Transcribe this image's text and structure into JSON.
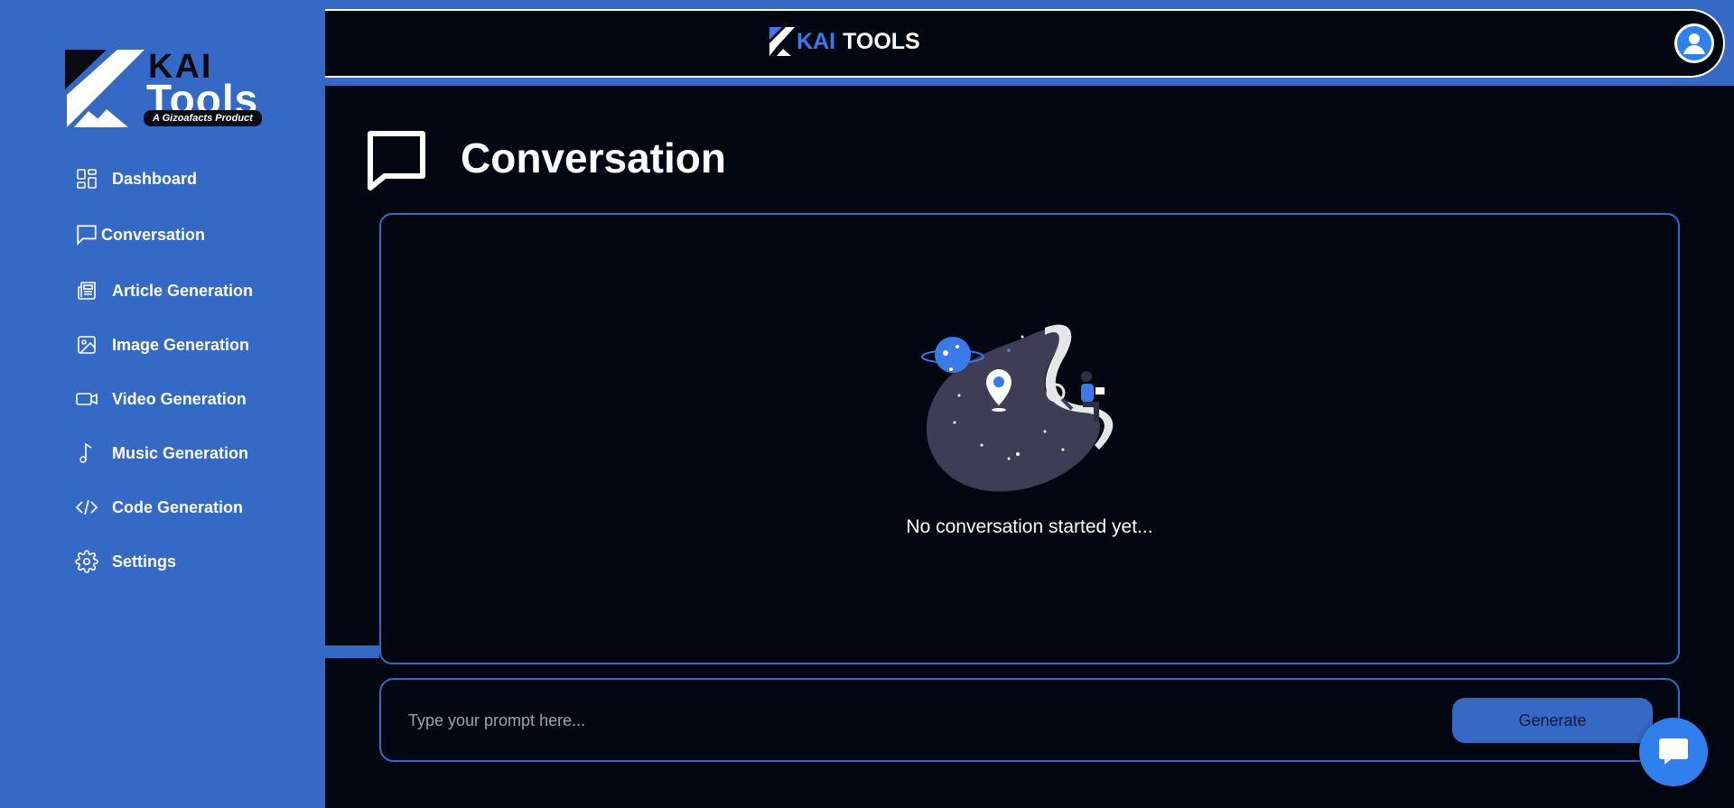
{
  "brand": {
    "sidebar_logo_kai": "KAI",
    "sidebar_logo_tools": "Tools",
    "sidebar_logo_tagline": "A Gizoafacts Product",
    "top_logo_kai": "KAI",
    "top_logo_tools": "TOOLS"
  },
  "sidebar": {
    "items": [
      {
        "label": "Dashboard",
        "icon": "dashboard-grid-icon"
      },
      {
        "label": "Conversation",
        "icon": "chat-bubble-icon"
      },
      {
        "label": "Article Generation",
        "icon": "newspaper-icon"
      },
      {
        "label": "Image Generation",
        "icon": "image-icon"
      },
      {
        "label": "Video Generation",
        "icon": "video-camera-icon"
      },
      {
        "label": "Music Generation",
        "icon": "music-note-icon"
      },
      {
        "label": "Code Generation",
        "icon": "code-icon"
      },
      {
        "label": "Settings",
        "icon": "gear-icon"
      }
    ]
  },
  "main": {
    "title": "Conversation",
    "empty_state_text": "No conversation started yet...",
    "prompt_placeholder": "Type your prompt here...",
    "generate_label": "Generate"
  },
  "colors": {
    "accent": "#3469C6",
    "background": "#030712",
    "chat_widget": "#2f80ed"
  }
}
